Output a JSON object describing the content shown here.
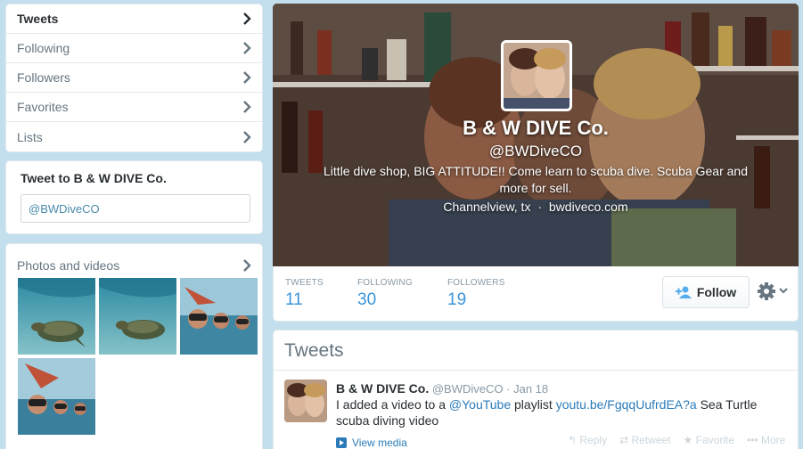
{
  "nav": {
    "items": [
      {
        "label": "Tweets"
      },
      {
        "label": "Following"
      },
      {
        "label": "Followers"
      },
      {
        "label": "Favorites"
      },
      {
        "label": "Lists"
      }
    ]
  },
  "tweet_to": {
    "title": "Tweet to B & W DIVE Co.",
    "input_value": "@BWDiveCO"
  },
  "photos": {
    "title": "Photos and videos"
  },
  "profile": {
    "name": "B & W DIVE Co.",
    "handle": "@BWDiveCO",
    "bio": "Little dive shop, BIG ATTITUDE!! Come learn to scuba dive. Scuba Gear and more for sell.",
    "location": "Channelview, tx",
    "separator": "·",
    "website": "bwdiveco.com"
  },
  "stats": {
    "tweets_label": "TWEETS",
    "tweets_value": "11",
    "following_label": "FOLLOWING",
    "following_value": "30",
    "followers_label": "FOLLOWERS",
    "followers_value": "19"
  },
  "actions": {
    "follow_label": "Follow",
    "follow_icon": "add-user-icon",
    "gear_icon": "gear-icon"
  },
  "timeline": {
    "title": "Tweets",
    "tweet": {
      "author_name": "B & W DIVE Co.",
      "author_handle": "@BWDiveCO",
      "dot": "·",
      "date": "Jan 18",
      "text_pre": "I added a video to a",
      "mention": "@YouTube",
      "text_mid": "playlist",
      "url": "youtu.be/FgqqUufrdEA?a",
      "text_post": "Sea Turtle scuba diving video",
      "view_media": "View media",
      "reply": "Reply",
      "retweet": "Retweet",
      "favorite": "Favorite",
      "more": "More"
    }
  },
  "colors": {
    "page_bg": "#c3dfee",
    "link": "#2b7bb9",
    "stat_number": "#3b94d9"
  }
}
